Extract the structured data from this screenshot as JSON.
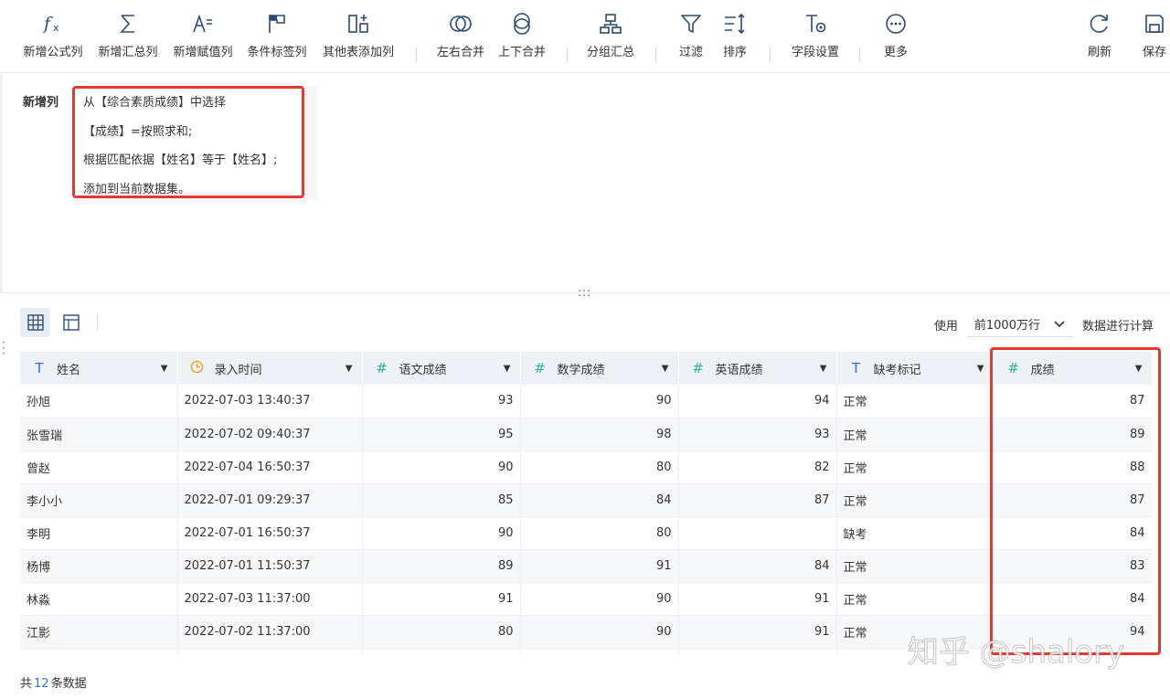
{
  "toolbar": {
    "items": [
      {
        "label": "新增公式列",
        "icon": "formula-icon"
      },
      {
        "label": "新增汇总列",
        "icon": "sigma-icon"
      },
      {
        "label": "新增赋值列",
        "icon": "assign-icon"
      },
      {
        "label": "条件标签列",
        "icon": "flag-icon"
      },
      {
        "label": "其他表添加列",
        "icon": "add-column-icon"
      },
      {
        "label": "左右合并",
        "icon": "merge-horizontal-icon"
      },
      {
        "label": "上下合并",
        "icon": "merge-vertical-icon"
      },
      {
        "label": "分组汇总",
        "icon": "group-icon"
      },
      {
        "label": "过滤",
        "icon": "filter-icon"
      },
      {
        "label": "排序",
        "icon": "sort-icon"
      },
      {
        "label": "字段设置",
        "icon": "field-settings-icon"
      },
      {
        "label": "更多",
        "icon": "more-icon"
      },
      {
        "label": "刷新",
        "icon": "refresh-icon"
      },
      {
        "label": "保存",
        "icon": "save-icon"
      }
    ]
  },
  "formula": {
    "title": "新增列",
    "lines": [
      "从【综合素质成绩】中选择",
      "【成绩】=按照求和;",
      "根据匹配依据【姓名】等于【姓名】;",
      "添加到当前数据集。"
    ]
  },
  "controls": {
    "use_label": "使用",
    "row_limit": "前1000万行",
    "compute_label": "数据进行计算"
  },
  "table": {
    "columns": [
      {
        "name": "姓名",
        "type_icon": "T"
      },
      {
        "name": "录入时间",
        "type_icon": "clock-icon"
      },
      {
        "name": "语文成绩",
        "type_icon": "#"
      },
      {
        "name": "数学成绩",
        "type_icon": "#"
      },
      {
        "name": "英语成绩",
        "type_icon": "#"
      },
      {
        "name": "缺考标记",
        "type_icon": "T"
      },
      {
        "name": "成绩",
        "type_icon": "#"
      }
    ],
    "rows": [
      [
        "孙旭",
        "2022-07-03 13:40:37",
        "93",
        "90",
        "94",
        "正常",
        "87"
      ],
      [
        "张雪瑞",
        "2022-07-02 09:40:37",
        "95",
        "98",
        "93",
        "正常",
        "89"
      ],
      [
        "曾赵",
        "2022-07-04 16:50:37",
        "90",
        "80",
        "82",
        "正常",
        "88"
      ],
      [
        "李小小",
        "2022-07-01 09:29:37",
        "85",
        "84",
        "87",
        "正常",
        "87"
      ],
      [
        "李明",
        "2022-07-01 16:50:37",
        "90",
        "80",
        "",
        "缺考",
        "84"
      ],
      [
        "杨博",
        "2022-07-01 11:50:37",
        "89",
        "91",
        "84",
        "正常",
        "83"
      ],
      [
        "林淼",
        "2022-07-03 11:37:00",
        "91",
        "90",
        "91",
        "正常",
        "84"
      ],
      [
        "江影",
        "2022-07-02 11:37:00",
        "80",
        "90",
        "91",
        "正常",
        "94"
      ]
    ]
  },
  "footer": {
    "prefix": "共",
    "count": "12",
    "suffix": "条数据"
  },
  "watermark": "知乎 @shalory",
  "colors": {
    "highlight": "#e53935",
    "accent": "#2f6fd6",
    "number_icon": "#2bb39a",
    "text_icon": "#2f6fd6",
    "clock_icon": "#f0a020"
  }
}
